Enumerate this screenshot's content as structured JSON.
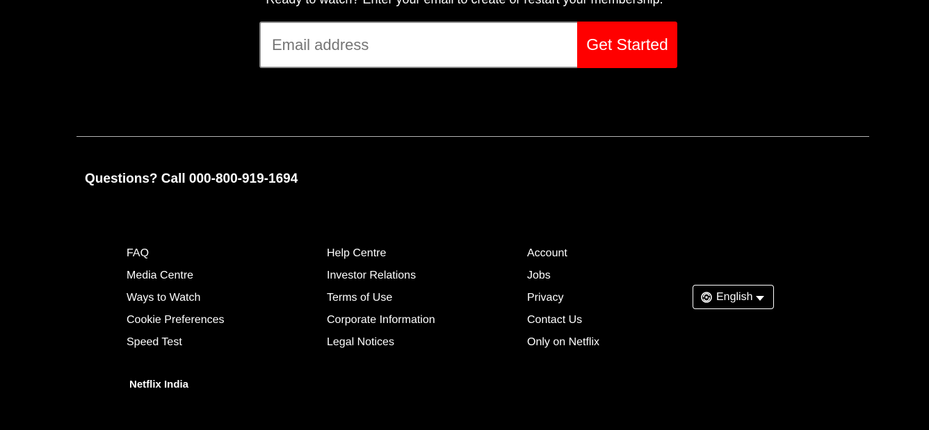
{
  "cta": {
    "text": "Ready to watch? Enter your email to create or restart your membership.",
    "email_placeholder": "Email address",
    "button_label": "Get Started"
  },
  "footer": {
    "questions": "Questions? Call 000-800-919-1694",
    "columns": [
      [
        "FAQ",
        "Media Centre",
        "Ways to Watch",
        "Cookie Preferences",
        "Speed Test"
      ],
      [
        "Help Centre",
        "Investor Relations",
        "Terms of Use",
        "Corporate Information",
        "Legal Notices"
      ],
      [
        "Account",
        "Jobs",
        "Privacy",
        "Contact Us",
        "Only on Netflix"
      ]
    ],
    "language": {
      "selected": "English",
      "icon": "language-globe-icon"
    },
    "country": "Netflix India"
  },
  "colors": {
    "background": "#000000",
    "accent": "#ff0000",
    "text": "#ffffff",
    "divider": "#b3b3b3"
  }
}
